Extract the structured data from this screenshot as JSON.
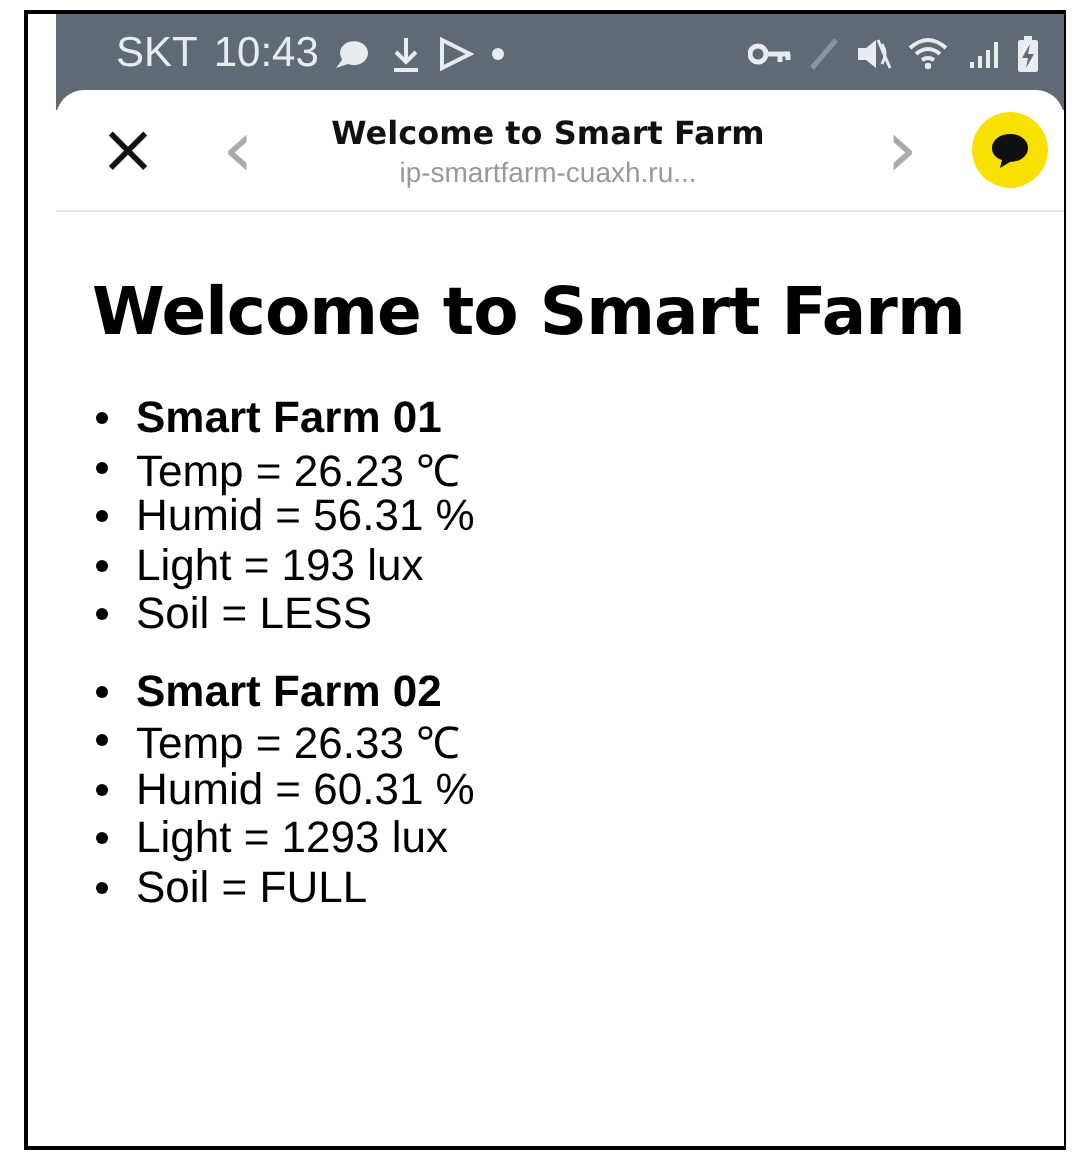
{
  "status_bar": {
    "carrier": "SKT",
    "time": "10:43"
  },
  "browser_bar": {
    "close": "×",
    "back": "‹",
    "forward": "›",
    "title": "Welcome to Smart Farm",
    "url": "ip-smartfarm-cuaxh.ru..."
  },
  "page": {
    "heading": "Welcome to Smart Farm",
    "farms": [
      {
        "items": [
          {
            "kind": "name",
            "text": "Smart Farm 01"
          },
          {
            "kind": "reading",
            "text": "Temp = 26.23 ℃"
          },
          {
            "kind": "reading",
            "text": "Humid = 56.31 %"
          },
          {
            "kind": "reading",
            "text": "Light = 193 lux"
          },
          {
            "kind": "reading",
            "text": "Soil = LESS"
          }
        ]
      },
      {
        "items": [
          {
            "kind": "name",
            "text": "Smart Farm 02"
          },
          {
            "kind": "reading",
            "text": "Temp = 26.33 ℃"
          },
          {
            "kind": "reading",
            "text": "Humid = 60.31 %"
          },
          {
            "kind": "reading",
            "text": "Light = 1293 lux"
          },
          {
            "kind": "reading",
            "text": "Soil = FULL"
          }
        ]
      }
    ]
  }
}
